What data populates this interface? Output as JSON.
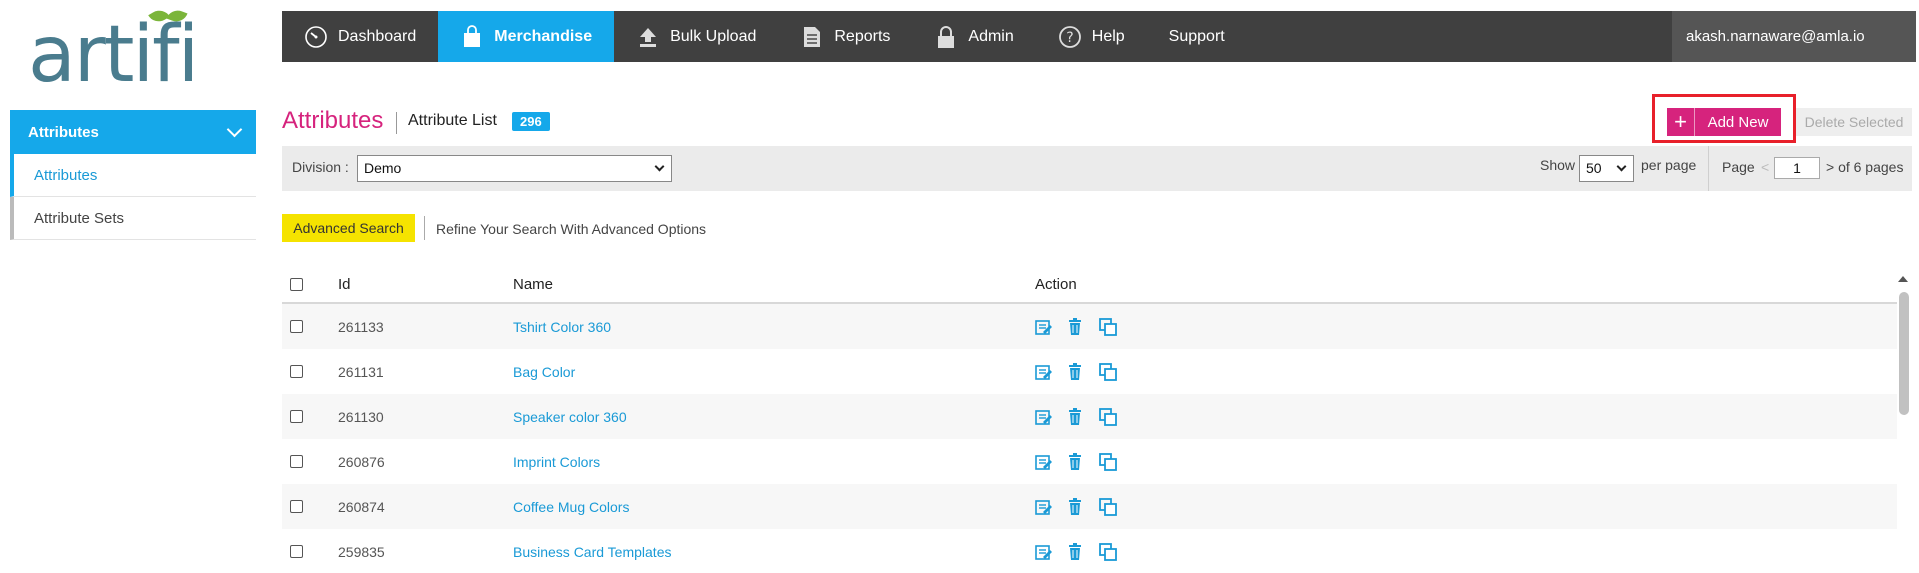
{
  "logo": {
    "text": "artifi"
  },
  "sidebar": {
    "header": "Attributes",
    "items": [
      {
        "label": "Attributes"
      },
      {
        "label": "Attribute Sets"
      }
    ]
  },
  "topnav": {
    "items": [
      {
        "label": "Dashboard",
        "icon": "gauge-icon"
      },
      {
        "label": "Merchandise",
        "icon": "shopping-bag-icon"
      },
      {
        "label": "Bulk Upload",
        "icon": "upload-icon"
      },
      {
        "label": "Reports",
        "icon": "document-icon"
      },
      {
        "label": "Admin",
        "icon": "lock-icon"
      },
      {
        "label": "Help",
        "icon": "help-icon"
      },
      {
        "label": "Support",
        "icon": ""
      }
    ],
    "user": "akash.narnaware@amla.io"
  },
  "page": {
    "title": "Attributes",
    "subtitle": "Attribute List",
    "count": "296",
    "add_new_label": "Add New",
    "add_plus": "+",
    "delete_selected_label": "Delete Selected"
  },
  "filter": {
    "division_label": "Division :",
    "division_value": "Demo",
    "show_label": "Show",
    "show_value": "50",
    "per_page_label": "per page",
    "page_label": "Page",
    "page_prev": "<",
    "page_value": "1",
    "page_total_text": "> of 6 pages"
  },
  "advanced": {
    "button_label": "Advanced Search",
    "hint": "Refine Your Search With Advanced Options"
  },
  "table": {
    "headers": {
      "id": "Id",
      "name": "Name",
      "action": "Action"
    },
    "rows": [
      {
        "id": "261133",
        "name": "Tshirt Color 360"
      },
      {
        "id": "261131",
        "name": "Bag Color"
      },
      {
        "id": "261130",
        "name": "Speaker color 360"
      },
      {
        "id": "260876",
        "name": "Imprint Colors"
      },
      {
        "id": "260874",
        "name": "Coffee Mug Colors"
      },
      {
        "id": "259835",
        "name": "Business Card Templates"
      }
    ]
  },
  "colors": {
    "accent": "#15a8ea",
    "brand_pink": "#d6237d",
    "nav_bg": "#404040",
    "highlight_outline": "#e8202a",
    "advanced_yellow": "#f5e300"
  }
}
